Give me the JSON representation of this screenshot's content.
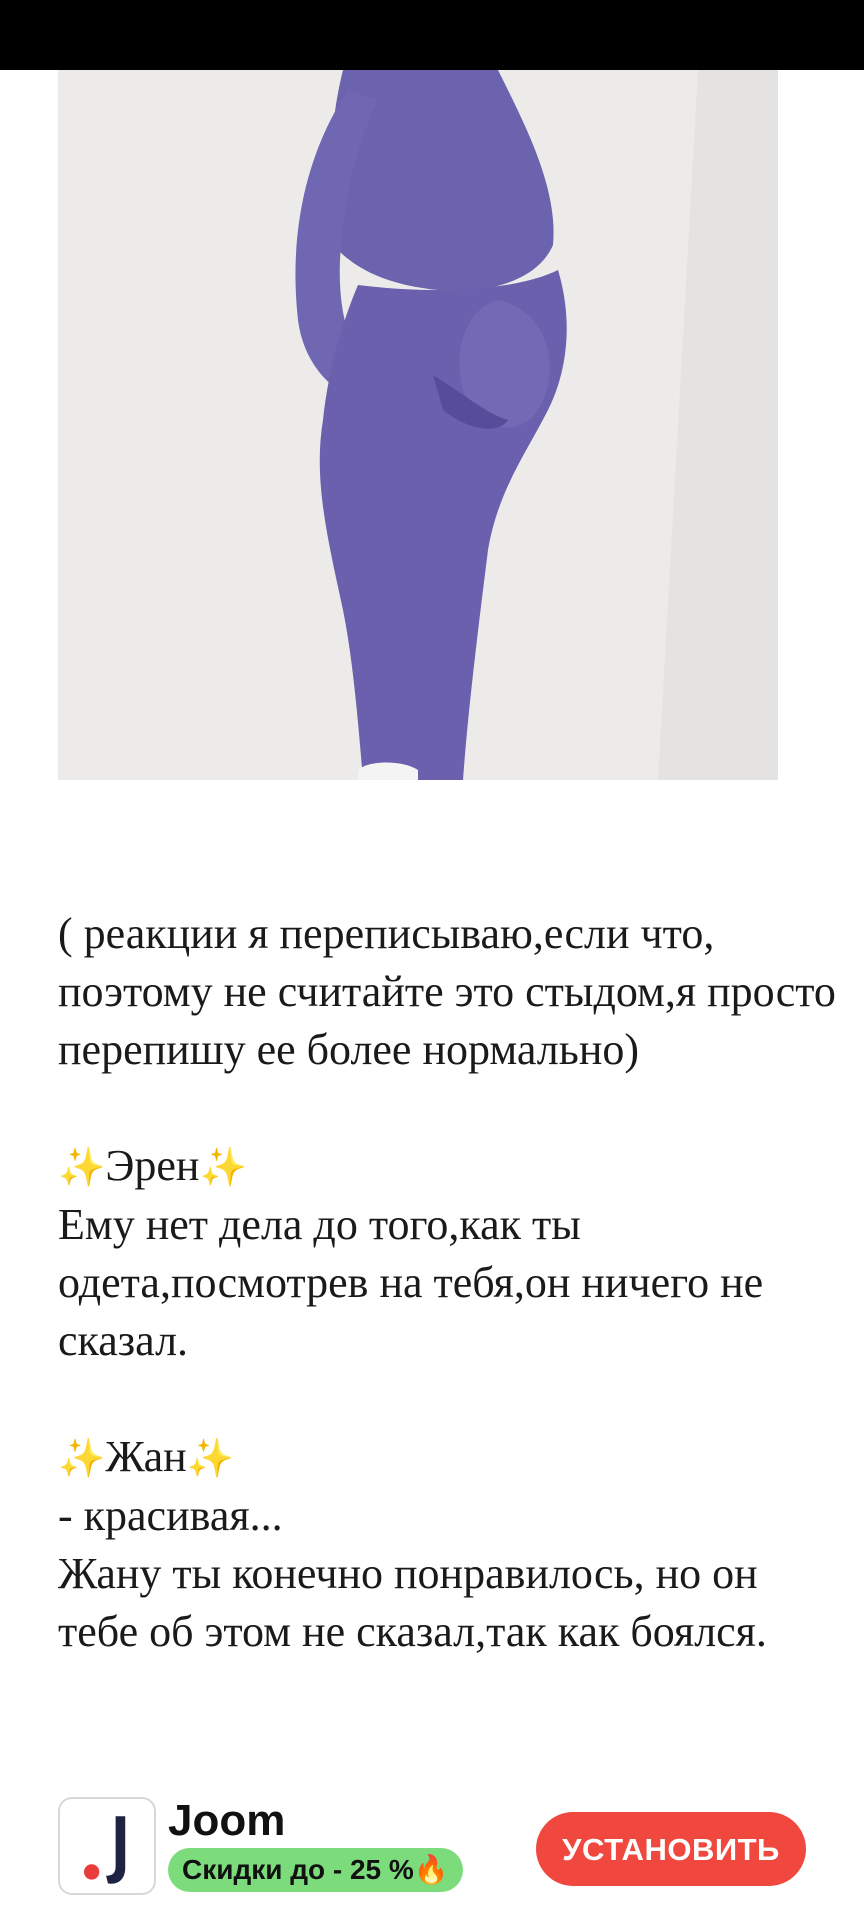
{
  "story": {
    "intro": "( реакции я переписываю,если что, поэтому не считайте это стыдом,я просто перепишу ее более нормально)",
    "sections": [
      {
        "heading": "Эрен",
        "lines": [
          "Ему нет дела до того,как ты одета,посмотрев на тебя,он ничего не сказал."
        ]
      },
      {
        "heading": "Жан",
        "lines": [
          "- красивая...",
          "Жану ты конечно понравилось, но он тебе об этом не сказал,так как боялся."
        ]
      }
    ],
    "sparkle_icon": "sparkles-icon"
  },
  "ad": {
    "app_name": "Joom",
    "badge_text": "Скидки до - 25 %",
    "badge_icon": "fire-icon",
    "install_label": "УСТАНОВИТЬ",
    "colors": {
      "install_button": "#f0483e",
      "badge": "#7cdc7c"
    }
  },
  "photo": {
    "icon": "image-icon",
    "subject_color": "#6b62ad"
  }
}
